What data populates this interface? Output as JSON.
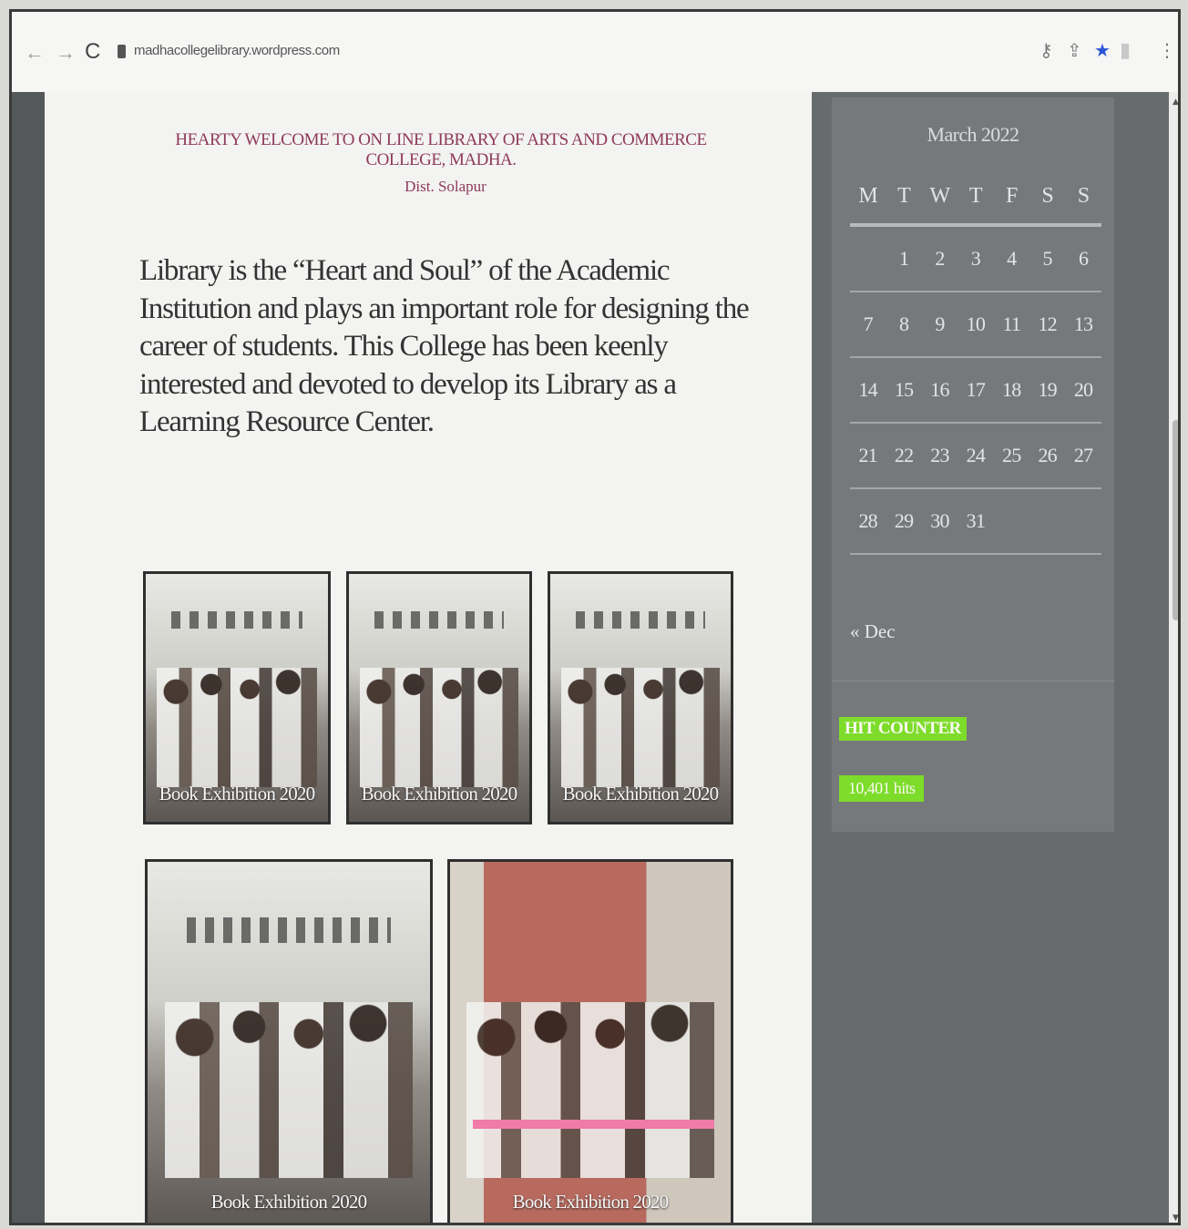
{
  "browser": {
    "back_icon": "←",
    "forward_icon": "→",
    "reload_icon": "C",
    "url": "madhacollegelibrary.wordpress.com",
    "icons": [
      "key-icon",
      "share-icon",
      "star-icon",
      "extension-icon",
      "menu-icon"
    ],
    "star_color": "#2a55d8"
  },
  "header": {
    "title_line1": "HEARTY WELCOME To ON LINE LIBRARY of ARTS and COMMERCE COLLEGE, MADHA.",
    "title_line2": "Dist. Solapur",
    "title_color": "#8e3a5c"
  },
  "intro": {
    "text": "Library is the “Heart and Soul” of the Academic Institution and plays an important role for designing the career of students. This College has been keenly interested and devoted to develop its Library as a Learning Resource Center."
  },
  "gallery": [
    {
      "caption": "Book Exhibition 2020"
    },
    {
      "caption": "Book Exhibition 2020"
    },
    {
      "caption": "Book Exhibition 2020"
    },
    {
      "caption": "Book Exhibition 2020"
    },
    {
      "caption": "Book Exhibition 2020"
    }
  ],
  "calendar": {
    "caption": "March 2022",
    "weekdays": [
      "M",
      "T",
      "W",
      "T",
      "F",
      "S",
      "S"
    ],
    "weeks": [
      [
        "",
        "1",
        "2",
        "3",
        "4",
        "5",
        "6"
      ],
      [
        "7",
        "8",
        "9",
        "10",
        "11",
        "12",
        "13"
      ],
      [
        "14",
        "15",
        "16",
        "17",
        "18",
        "19",
        "20"
      ],
      [
        "21",
        "22",
        "23",
        "24",
        "25",
        "26",
        "27"
      ],
      [
        "28",
        "29",
        "30",
        "31",
        "",
        "",
        ""
      ]
    ],
    "prev_link": "« Dec"
  },
  "hit_counter": {
    "title": "HIT COUNTER",
    "count": "10,401 hits",
    "highlight_color": "#7ddc2a"
  }
}
